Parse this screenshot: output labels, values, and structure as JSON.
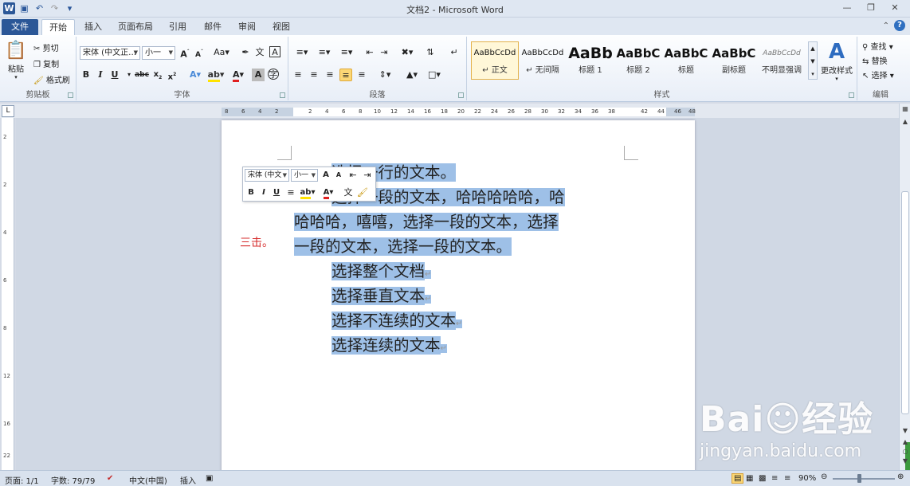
{
  "window": {
    "title": "文档2 - Microsoft Word"
  },
  "qat": {
    "icons": [
      "word-icon",
      "save-icon",
      "undo-icon",
      "redo-icon",
      "customize-icon"
    ]
  },
  "tabs": [
    {
      "label": "文件"
    },
    {
      "label": "开始"
    },
    {
      "label": "插入"
    },
    {
      "label": "页面布局"
    },
    {
      "label": "引用"
    },
    {
      "label": "邮件"
    },
    {
      "label": "审阅"
    },
    {
      "label": "视图"
    }
  ],
  "ribbon": {
    "clipboard": {
      "paste": "粘贴",
      "cut": "剪切",
      "copy": "复制",
      "format_painter": "格式刷",
      "label": "剪贴板"
    },
    "font": {
      "font_name": "宋体 (中文正…",
      "font_size": "小一",
      "label": "字体"
    },
    "paragraph": {
      "label": "段落"
    },
    "styles": {
      "label": "样式",
      "items": [
        {
          "sample": "AaBbCcDd",
          "name": "↵ 正文"
        },
        {
          "sample": "AaBbCcDd",
          "name": "↵ 无间隔"
        },
        {
          "sample": "AaBb",
          "name": "标题 1"
        },
        {
          "sample": "AaBbC",
          "name": "标题 2"
        },
        {
          "sample": "AaBbC",
          "name": "标题"
        },
        {
          "sample": "AaBbC",
          "name": "副标题"
        },
        {
          "sample": "AaBbCcDd",
          "name": "不明显强调"
        }
      ],
      "change_styles": "更改样式"
    },
    "editing": {
      "find": "查找",
      "replace": "替换",
      "select": "选择",
      "label": "编辑"
    }
  },
  "ruler": {
    "ticks": [
      "8",
      "6",
      "4",
      "2",
      "2",
      "4",
      "6",
      "8",
      "10",
      "12",
      "14",
      "16",
      "18",
      "20",
      "22",
      "24",
      "26",
      "28",
      "30",
      "32",
      "34",
      "36",
      "38",
      "42",
      "44",
      "46",
      "48"
    ]
  },
  "mini_toolbar": {
    "font_name": "宋体 (中文",
    "font_size": "小一"
  },
  "document": {
    "lines": [
      "选择一行的文本。",
      "选择一段的文本，哈哈哈哈哈，哈",
      "哈哈哈，嘻嘻，选择一段的文本，选择",
      "一段的文本，选择一段的文本。",
      "选择整个文档",
      "选择垂直文本",
      "选择不连续的文本",
      "选择连续的文本"
    ],
    "side_note": "三击。"
  },
  "statusbar": {
    "page": "页面: 1/1",
    "words": "字数: 79/79",
    "language": "中文(中国)",
    "mode": "插入",
    "zoom": "90%"
  },
  "watermark": {
    "brand": "Bai☺经验",
    "url": "jingyan.baidu.com"
  }
}
